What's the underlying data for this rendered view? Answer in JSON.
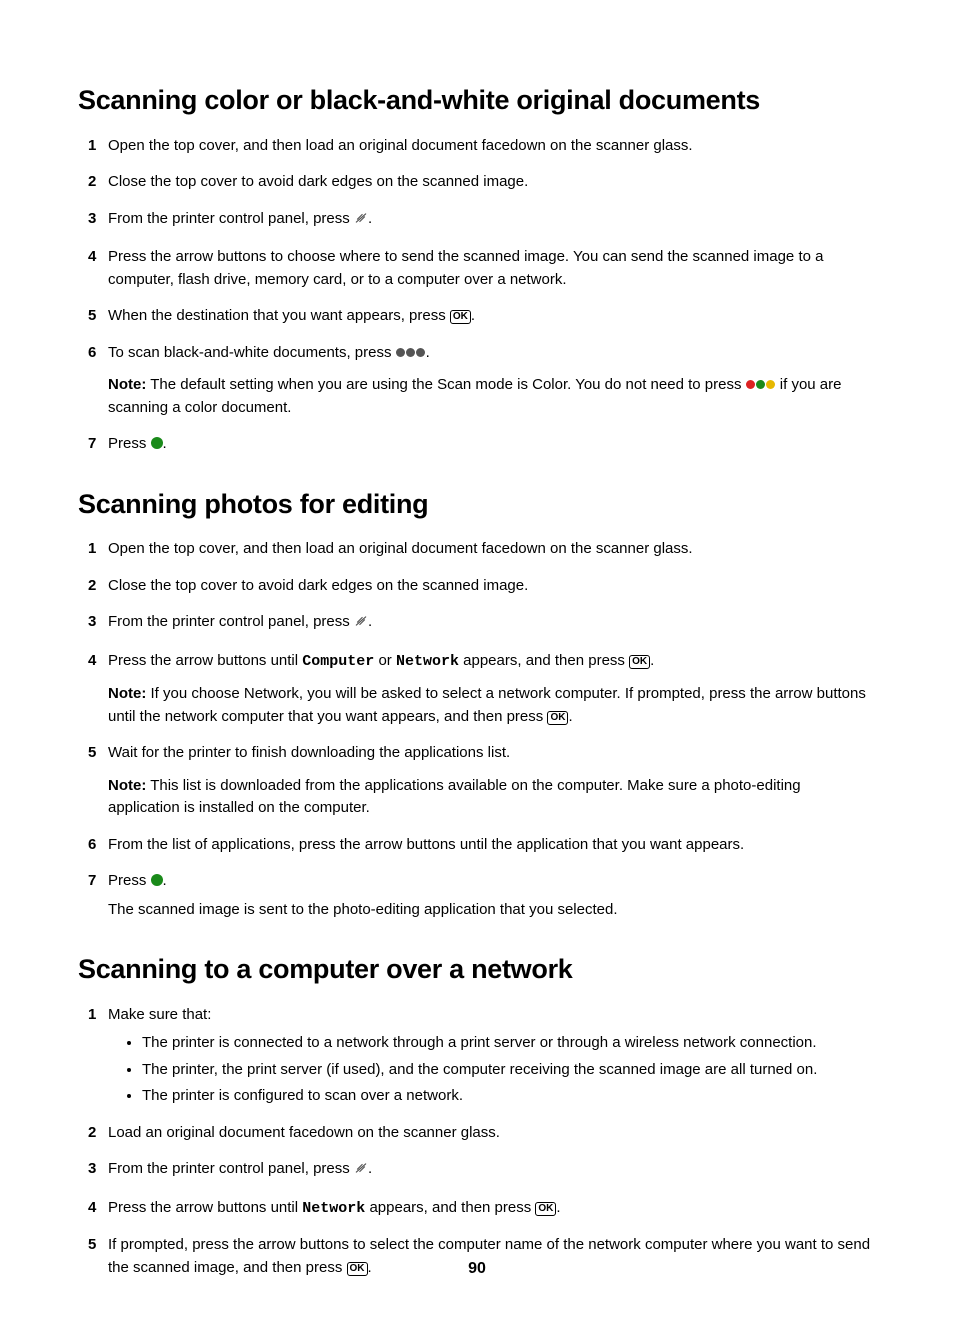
{
  "page_number": "90",
  "labels": {
    "note": "Note:",
    "ok": "OK"
  },
  "mono": {
    "computer": "Computer",
    "network": "Network"
  },
  "sec1": {
    "heading": "Scanning color or black-and-white original documents",
    "s1": "Open the top cover, and then load an original document facedown on the scanner glass.",
    "s2": "Close the top cover to avoid dark edges on the scanned image.",
    "s3a": "From the printer control panel, press ",
    "s3b": ".",
    "s4": "Press the arrow buttons to choose where to send the scanned image. You can send the scanned image to a computer, flash drive, memory card, or to a computer over a network.",
    "s5a": "When the destination that you want appears, press ",
    "s5b": ".",
    "s6a": "To scan black-and-white documents, press ",
    "s6b": ".",
    "note6a": " The default setting when you are using the Scan mode is Color. You do not need to press ",
    "note6b": " if you are scanning a color document.",
    "s7a": "Press ",
    "s7b": "."
  },
  "sec2": {
    "heading": "Scanning photos for editing",
    "s1": "Open the top cover, and then load an original document facedown on the scanner glass.",
    "s2": "Close the top cover to avoid dark edges on the scanned image.",
    "s3a": "From the printer control panel, press ",
    "s3b": ".",
    "s4a": "Press the arrow buttons until ",
    "s4b": " or ",
    "s4c": " appears, and then press ",
    "s4d": ".",
    "note4a": " If you choose Network, you will be asked to select a network computer. If prompted, press the arrow buttons until the network computer that you want appears, and then press ",
    "note4b": ".",
    "s5": "Wait for the printer to finish downloading the applications list.",
    "note5": " This list is downloaded from the applications available on the computer. Make sure a photo-editing application is installed on the computer.",
    "s6": "From the list of applications, press the arrow buttons until the application that you want appears.",
    "s7a": "Press ",
    "s7b": ".",
    "s7after": "The scanned image is sent to the photo-editing application that you selected."
  },
  "sec3": {
    "heading": "Scanning to a computer over a network",
    "s1": "Make sure that:",
    "b1": "The printer is connected to a network through a print server or through a wireless network connection.",
    "b2": "The printer, the print server (if used), and the computer receiving the scanned image are all turned on.",
    "b3": "The printer is configured to scan over a network.",
    "s2": "Load an original document facedown on the scanner glass.",
    "s3a": "From the printer control panel, press ",
    "s3b": ".",
    "s4a": "Press the arrow buttons until ",
    "s4b": " appears, and then press ",
    "s4c": ".",
    "s5a": "If prompted, press the arrow buttons to select the computer name of the network computer where you want to send the scanned image, and then press ",
    "s5b": "."
  }
}
